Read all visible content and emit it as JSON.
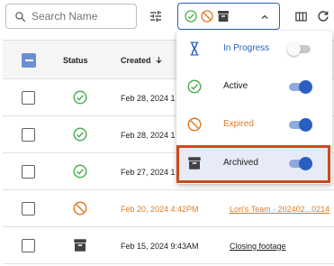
{
  "toolbar": {
    "search": {
      "placeholder": "Search Name",
      "icon": "search-icon"
    },
    "filter_icon": "tune-icon",
    "filter_button": {
      "icons": [
        "check-circle-icon",
        "block-icon",
        "archive-icon"
      ],
      "expanded": true,
      "accent": "#2a5fc1"
    },
    "columns_icon": "view-columns-icon",
    "refresh_icon": "refresh-icon"
  },
  "table": {
    "headers": {
      "status": "Status",
      "created": "Created",
      "sort": "descending"
    },
    "rows": [
      {
        "status": "active",
        "created": "Feb 28, 2024 1",
        "name": ""
      },
      {
        "status": "active",
        "created": "Feb 28, 2024 1",
        "name": ""
      },
      {
        "status": "active",
        "created": "Feb 27, 2024 1",
        "name": ""
      },
      {
        "status": "expired",
        "created": "Feb 20, 2024 4:42PM",
        "name": "Lori's Team - 202402...0214"
      },
      {
        "status": "archived",
        "created": "Feb 15, 2024 9:43AM",
        "name": "Closing footage"
      }
    ]
  },
  "status_menu": {
    "items": [
      {
        "label": "In Progress",
        "icon": "hourglass-icon",
        "enabled": false,
        "color": "#2a5fc1"
      },
      {
        "label": "Active",
        "icon": "check-circle-icon",
        "enabled": true,
        "color": "#212121"
      },
      {
        "label": "Expired",
        "icon": "block-icon",
        "enabled": true,
        "color": "#e07b24"
      },
      {
        "label": "Archived",
        "icon": "archive-icon",
        "enabled": true,
        "color": "#212121",
        "highlighted": true
      }
    ]
  },
  "colors": {
    "active": "#4caf50",
    "expired": "#e07b24",
    "archived": "#424242",
    "accent": "#2a5fc1",
    "highlight_border": "#cf4a1b"
  }
}
